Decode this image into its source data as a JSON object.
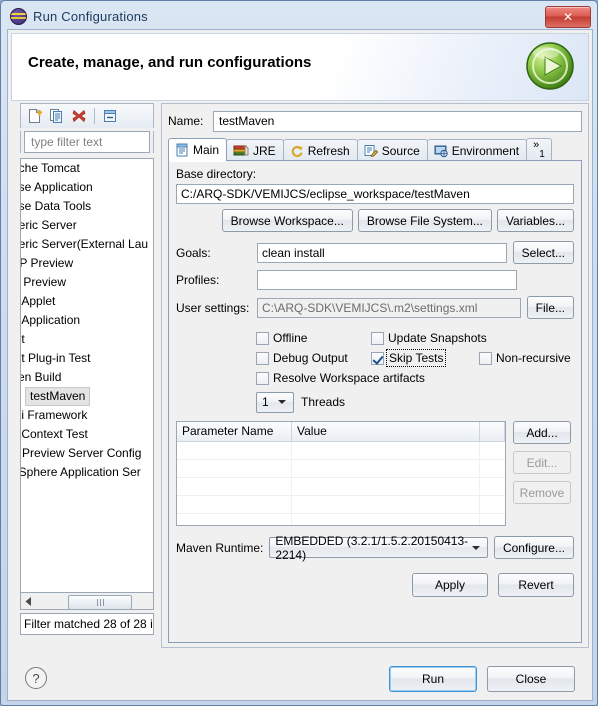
{
  "window": {
    "title": "Run Configurations",
    "close_label": "✕",
    "logo_icon": "eclipse-logo-icon"
  },
  "banner": {
    "heading": "Create, manage, and run configurations",
    "run_icon": "run-large-icon"
  },
  "tree_toolbar": {
    "items": [
      {
        "name": "new-launch-configuration-icon",
        "tip": "New launch configuration"
      },
      {
        "name": "duplicate-icon",
        "tip": "Duplicate"
      },
      {
        "name": "delete-icon",
        "tip": "Delete"
      },
      {
        "name": "collapse-all-icon",
        "tip": "Collapse All"
      }
    ]
  },
  "filter": {
    "placeholder": "type filter text",
    "value": "",
    "status": "Filter matched 28 of 28 i"
  },
  "tree": {
    "items": [
      {
        "label": "ache Tomcat",
        "selected": false
      },
      {
        "label": "pse Application",
        "selected": false
      },
      {
        "label": "pse Data Tools",
        "selected": false
      },
      {
        "label": "neric Server",
        "selected": false
      },
      {
        "label": "neric Server(External Lau",
        "selected": false
      },
      {
        "label": "TP Preview",
        "selected": false
      },
      {
        "label": "E Preview",
        "selected": false
      },
      {
        "label": "a Applet",
        "selected": false
      },
      {
        "label": "a Application",
        "selected": false
      },
      {
        "label": "nit",
        "selected": false
      },
      {
        "label": "nit Plug-in Test",
        "selected": false
      },
      {
        "label": "ven Build",
        "selected": false
      },
      {
        "label": "testMaven",
        "selected": true
      },
      {
        "label": "Gi Framework",
        "selected": false
      },
      {
        "label": "k Context Test",
        "selected": false
      },
      {
        "label": "b Preview Server Config",
        "selected": false
      },
      {
        "label": "bSphere Application Ser",
        "selected": false
      }
    ]
  },
  "config": {
    "name_label": "Name:",
    "name_value": "testMaven",
    "tabs": [
      {
        "label": "Main",
        "icon": "main-tab-icon",
        "active": true
      },
      {
        "label": "JRE",
        "icon": "jre-tab-icon",
        "active": false
      },
      {
        "label": "Refresh",
        "icon": "refresh-tab-icon",
        "active": false
      },
      {
        "label": "Source",
        "icon": "source-tab-icon",
        "active": false
      },
      {
        "label": "Environment",
        "icon": "environment-tab-icon",
        "active": false
      }
    ],
    "tab_overflow": "»",
    "tab_overflow_count": "1"
  },
  "main_tab": {
    "base_directory_label": "Base directory:",
    "base_directory_value": "C:/ARQ-SDK/VEMIJCS/eclipse_workspace/testMaven",
    "browse_workspace_label": "Browse Workspace...",
    "browse_file_system_label": "Browse File System...",
    "variables_label": "Variables...",
    "goals_label": "Goals:",
    "goals_value": "clean install",
    "select_label": "Select...",
    "profiles_label": "Profiles:",
    "profiles_value": "",
    "user_settings_label": "User settings:",
    "user_settings_value": "C:\\ARQ-SDK\\VEMIJCS\\.m2\\settings.xml",
    "file_label": "File...",
    "checkboxes": [
      {
        "label": "Offline",
        "checked": false,
        "focused": false
      },
      {
        "label": "Update Snapshots",
        "checked": false,
        "focused": false
      },
      {
        "label": "Debug Output",
        "checked": false,
        "focused": false
      },
      {
        "label": "Skip Tests",
        "checked": true,
        "focused": true
      },
      {
        "label": "Non-recursive",
        "checked": false,
        "focused": false
      },
      {
        "label": "Resolve Workspace artifacts",
        "checked": false,
        "focused": false
      }
    ],
    "threads_value": "1",
    "threads_label": "Threads",
    "parameters_table": {
      "columns": [
        "Parameter Name",
        "Value"
      ],
      "rows": []
    },
    "add_label": "Add...",
    "edit_label": "Edit...",
    "remove_label": "Remove",
    "maven_runtime_label": "Maven Runtime:",
    "maven_runtime_value": "EMBEDDED (3.2.1/1.5.2.20150413-2214)",
    "configure_label": "Configure..."
  },
  "actions": {
    "apply_label": "Apply",
    "revert_label": "Revert",
    "run_label": "Run",
    "close_label": "Close",
    "help_label": "?"
  },
  "colors": {
    "accent": "#3c93d6",
    "danger": "#c03c33",
    "run_green": "#5aa72e",
    "title_text": "#1b3a5c"
  }
}
